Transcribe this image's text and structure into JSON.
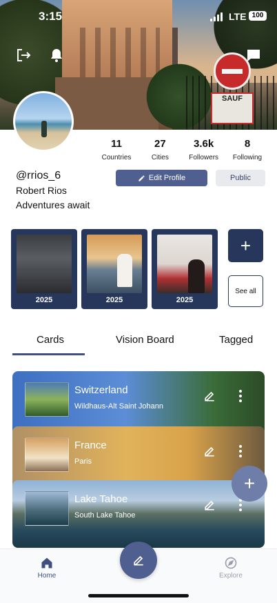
{
  "status_bar": {
    "time": "3:15",
    "network": "LTE",
    "battery": "100"
  },
  "profile": {
    "username": "@rrios_6",
    "name": "Robert Rios",
    "bio": "Adventures await"
  },
  "stats": [
    {
      "value": "11",
      "label": "Countries"
    },
    {
      "value": "27",
      "label": "Cities"
    },
    {
      "value": "3.6k",
      "label": "Followers"
    },
    {
      "value": "8",
      "label": "Following"
    }
  ],
  "actions": {
    "edit_profile": "Edit Profile",
    "visibility": "Public"
  },
  "cover": {
    "sign_text": "SAUF"
  },
  "highlights": [
    {
      "year": "2025"
    },
    {
      "year": "2025"
    },
    {
      "year": "2025"
    }
  ],
  "highlight_actions": {
    "add": "+",
    "see_all": "See all"
  },
  "tabs": [
    {
      "label": "Cards"
    },
    {
      "label": "Vision Board"
    },
    {
      "label": "Tagged"
    }
  ],
  "cards": [
    {
      "title": "Switzerland",
      "subtitle": "Wildhaus-Alt Saint Johann"
    },
    {
      "title": "France",
      "subtitle": "Paris"
    },
    {
      "title": "Lake Tahoe",
      "subtitle": "South Lake Tahoe"
    }
  ],
  "fab": {
    "label": "+"
  },
  "bottom_nav": {
    "home": "Home",
    "explore": "Explore"
  },
  "colors": {
    "primary": "#4f6090",
    "navy": "#27375c",
    "accent": "#3f5080"
  },
  "icons": [
    "logout-icon",
    "bell-icon",
    "chat-icon",
    "pencil-icon",
    "more-vertical-icon",
    "home-icon",
    "compass-icon",
    "plus-icon"
  ]
}
